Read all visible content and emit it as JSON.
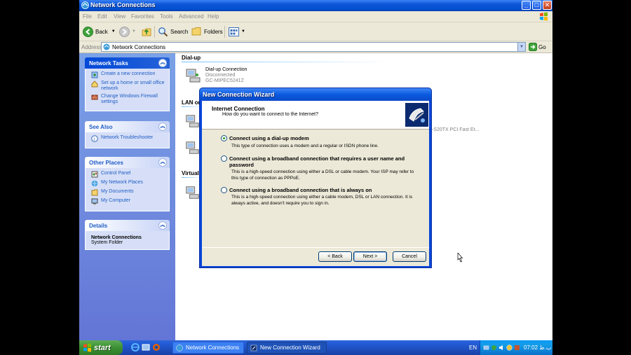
{
  "window": {
    "title": "Network Connections",
    "controls": {
      "minimize": "_",
      "maximize": "□",
      "close": "✕"
    }
  },
  "menu": [
    "File",
    "Edit",
    "View",
    "Favorites",
    "Tools",
    "Advanced",
    "Help"
  ],
  "toolbar": {
    "back": "Back",
    "search": "Search",
    "folders": "Folders"
  },
  "address": {
    "label": "Address",
    "value": "Network Connections",
    "go": "Go"
  },
  "task_pane": {
    "network_tasks": {
      "title": "Network Tasks",
      "items": [
        {
          "label": "Create a new connection",
          "icon": "new-connection-icon"
        },
        {
          "label": "Set up a home or small office network",
          "icon": "home-network-icon"
        },
        {
          "label": "Change Windows Firewall settings",
          "icon": "firewall-icon"
        }
      ]
    },
    "see_also": {
      "title": "See Also",
      "items": [
        {
          "label": "Network Troubleshooter",
          "icon": "help-icon"
        }
      ]
    },
    "other_places": {
      "title": "Other Places",
      "items": [
        {
          "label": "Control Panel",
          "icon": "control-panel-icon"
        },
        {
          "label": "My Network Places",
          "icon": "network-places-icon"
        },
        {
          "label": "My Documents",
          "icon": "documents-icon"
        },
        {
          "label": "My Computer",
          "icon": "computer-icon"
        }
      ]
    },
    "details": {
      "title": "Details",
      "name": "Network Connections",
      "type": "System Folder"
    }
  },
  "main": {
    "groups": {
      "dialup": "Dial-up",
      "lan": "LAN or",
      "virtual": "Virtual"
    },
    "dialup_item": {
      "name": "Dial-up Connection",
      "status": "Disconnected",
      "device": "GC-MIPEC5241Z"
    },
    "lan_device_fragment": "-S20TX PCI Fast Et..."
  },
  "wizard": {
    "title": "New Connection Wizard",
    "header_title": "Internet Connection",
    "header_subtitle": "How do you want to connect to the Internet?",
    "options": [
      {
        "label": "Connect using a dial-up modem",
        "description": "This type of connection uses a modem and a regular or ISDN phone line.",
        "selected": true
      },
      {
        "label": "Connect using a broadband connection that requires a user name and password",
        "description": "This is a high-speed connection using either a DSL or cable modem. Your ISP may refer to this type of connection as PPPoE.",
        "selected": false
      },
      {
        "label": "Connect using a broadband connection that is always on",
        "description": "This is a high-speed connection using either a cable modem, DSL or LAN connection. It is always active, and doesn't require you to sign in.",
        "selected": false
      }
    ],
    "buttons": {
      "back": "< Back",
      "next": "Next >",
      "cancel": "Cancel"
    }
  },
  "taskbar": {
    "start": "start",
    "tasks": [
      {
        "label": "Network Connections",
        "active": false
      },
      {
        "label": "New Connection Wizard",
        "active": true
      }
    ],
    "language": "EN",
    "clock": "07:02 ب.ظ"
  },
  "colors": {
    "xp_blue": "#0a55d8",
    "task_pane_bg": "#7ba2e7",
    "dialog_face": "#ece9d8",
    "start_green": "#3c8f33"
  }
}
